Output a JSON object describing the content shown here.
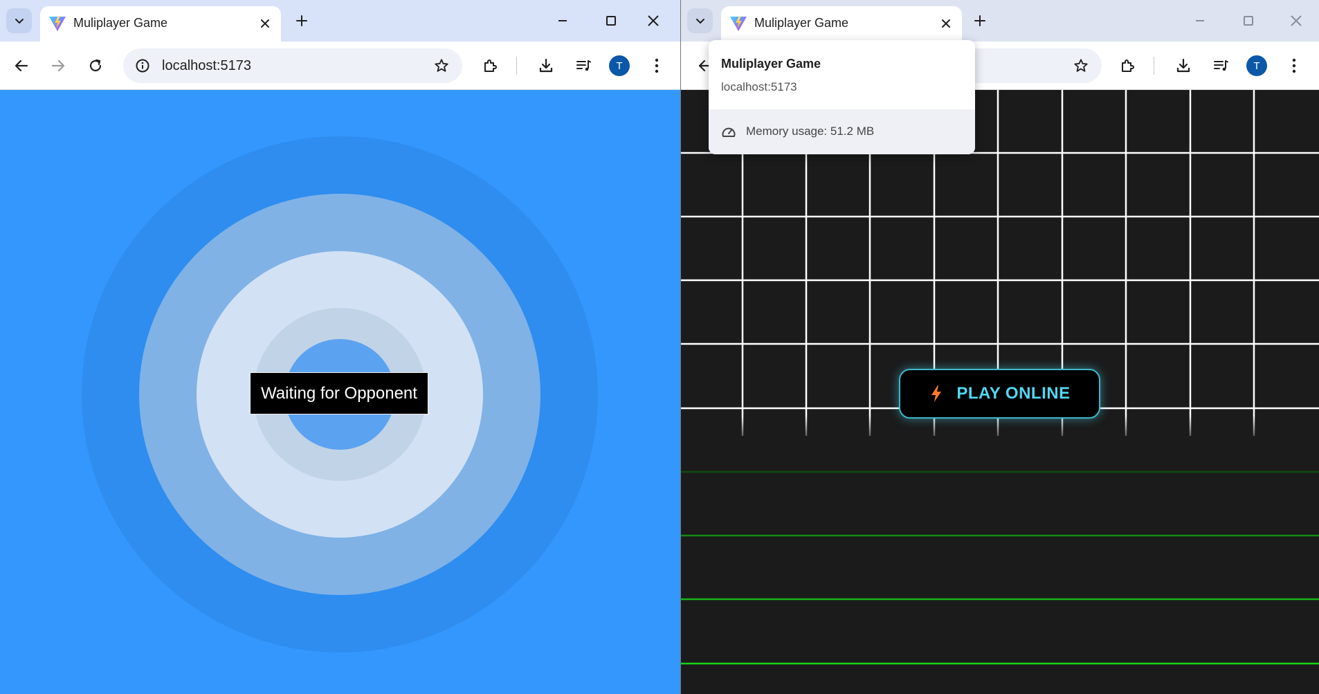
{
  "left_window": {
    "tab": {
      "title": "Muliplayer Game",
      "favicon": "vite-logo-icon"
    },
    "address": {
      "url": "localhost:5173"
    },
    "profile_initial": "T",
    "waiting_text": "Waiting for Opponent"
  },
  "right_window": {
    "tab": {
      "title": "Muliplayer Game",
      "favicon": "vite-logo-icon"
    },
    "profile_initial": "T",
    "hover_card": {
      "title": "Muliplayer Game",
      "url": "localhost:5173",
      "memory": "Memory usage: 51.2 MB"
    },
    "play_button": {
      "label": "PLAY ONLINE",
      "icon": "lightning-bolt-icon"
    }
  },
  "colors": {
    "left_background": "#3497fd",
    "right_background": "#1b1b1b",
    "grid_top": "#ffffff",
    "grid_bottom": "#16d016",
    "play_accent": "#52d7f2",
    "bolt": "#ff7a29"
  }
}
